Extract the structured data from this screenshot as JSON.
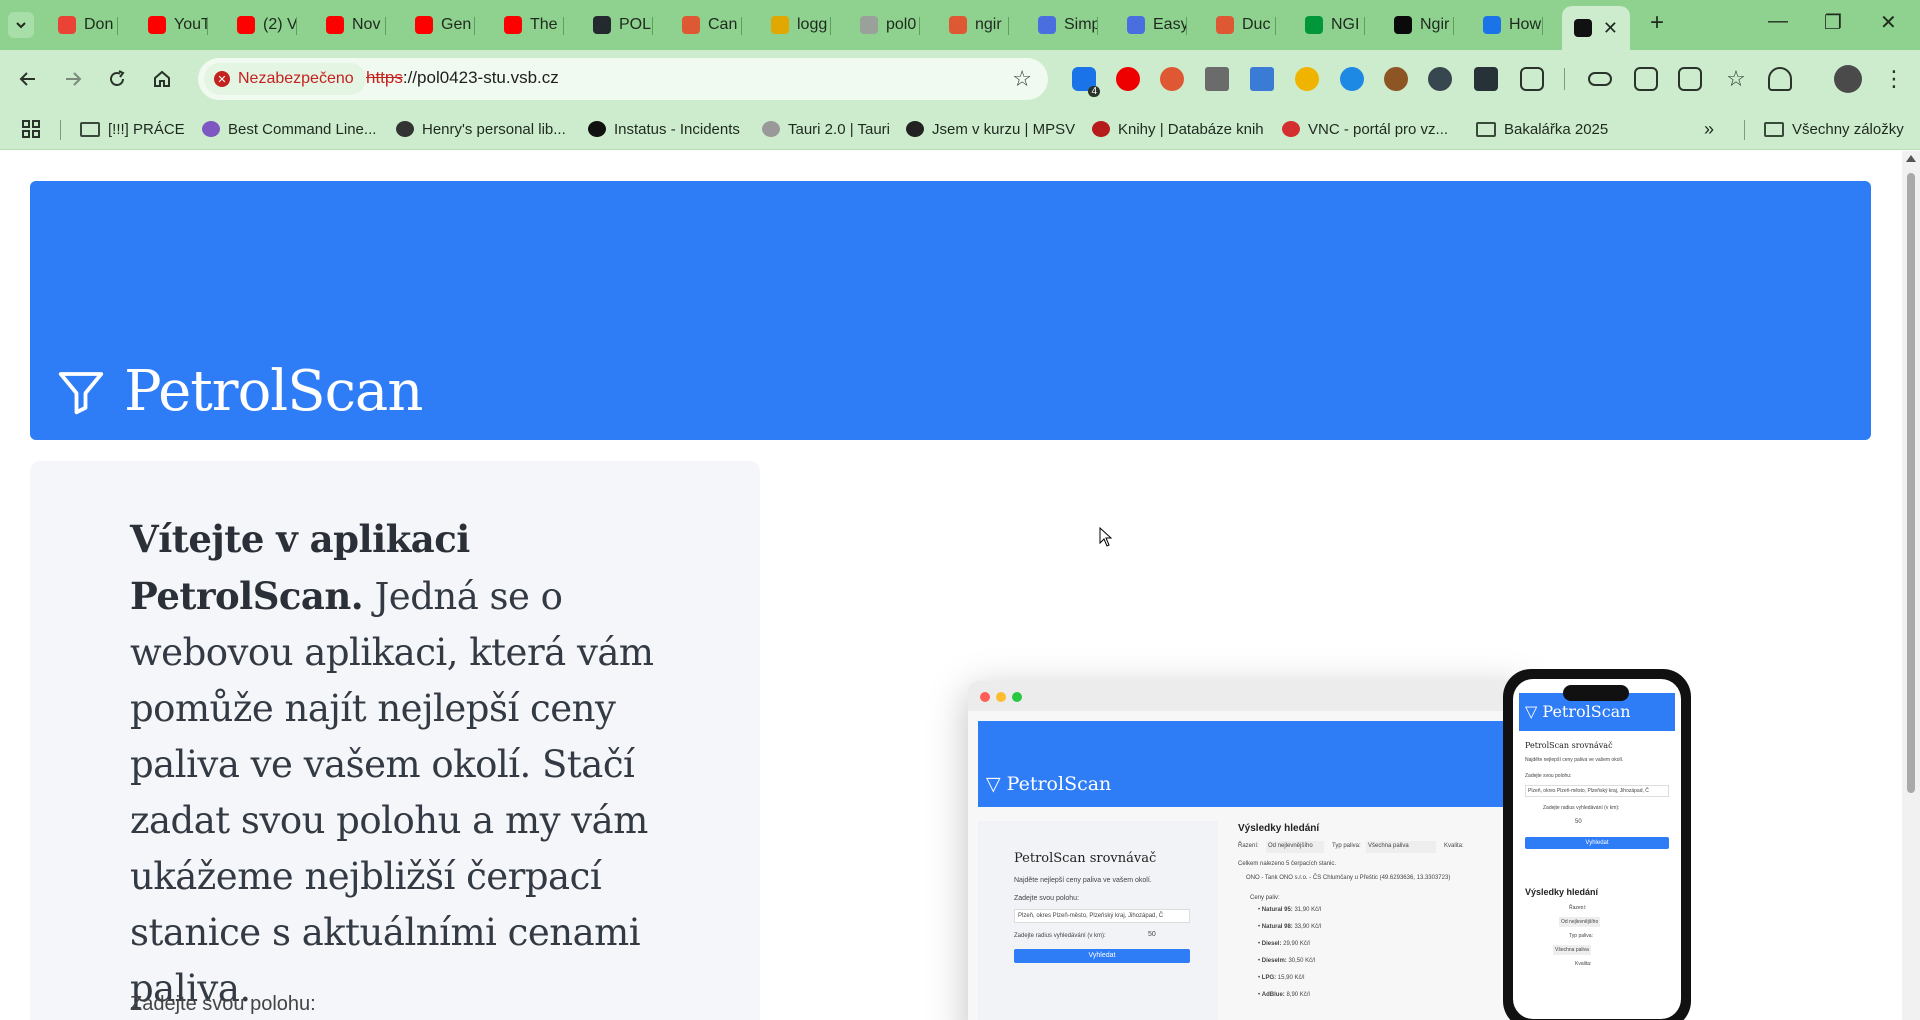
{
  "browser": {
    "tabs": [
      {
        "label": "Don",
        "favicon_color": "#ea4335",
        "favicon": "gmail-icon"
      },
      {
        "label": "YouT",
        "favicon_color": "#ff0000",
        "favicon": "youtube-icon"
      },
      {
        "label": "(2) V",
        "favicon_color": "#ff0000",
        "favicon": "youtube-icon"
      },
      {
        "label": "Nov",
        "favicon_color": "#ff0000",
        "favicon": "youtube-icon"
      },
      {
        "label": "Gen",
        "favicon_color": "#ff0000",
        "favicon": "youtube-icon"
      },
      {
        "label": "The",
        "favicon_color": "#ff0000",
        "favicon": "youtube-icon"
      },
      {
        "label": "POL",
        "favicon_color": "#24292f",
        "favicon": "github-icon"
      },
      {
        "label": "Can",
        "favicon_color": "#de5833",
        "favicon": "duckduckgo-icon"
      },
      {
        "label": "logg",
        "favicon_color": "#e0a800",
        "favicon": "logo-icon"
      },
      {
        "label": "pol0",
        "favicon_color": "#9aa09a",
        "favicon": "globe-icon"
      },
      {
        "label": "ngir",
        "favicon_color": "#de5833",
        "favicon": "duckduckgo-icon"
      },
      {
        "label": "Simp",
        "favicon_color": "#4a6ee0",
        "favicon": "azure-icon"
      },
      {
        "label": "Easy",
        "favicon_color": "#4a6ee0",
        "favicon": "azure-icon"
      },
      {
        "label": "Duc",
        "favicon_color": "#de5833",
        "favicon": "duckduckgo-icon"
      },
      {
        "label": "NGI",
        "favicon_color": "#009639",
        "favicon": "nginx-icon"
      },
      {
        "label": "Ngir",
        "favicon_color": "#0a0a0a",
        "favicon": "dev-icon"
      },
      {
        "label": "How",
        "favicon_color": "#1a73e8",
        "favicon": "loading-icon"
      },
      {
        "label": "",
        "favicon_color": "#111111",
        "favicon": "triangle-icon",
        "active": true
      }
    ],
    "security_label": "Nezabezpečeno",
    "url_scheme": "https",
    "url_rest": "://pol0423-stu.vsb.cz",
    "extension_badge": "4",
    "bookmarks": [
      {
        "label": "[!!!] PRÁCE",
        "type": "folder"
      },
      {
        "label": "Best Command Line...",
        "type": "link",
        "color": "#7e57c2"
      },
      {
        "label": "Henry's personal lib...",
        "type": "link",
        "color": "#333333"
      },
      {
        "label": "Instatus - Incidents",
        "type": "link",
        "color": "#111111"
      },
      {
        "label": "Tauri 2.0 | Tauri",
        "type": "link",
        "color": "#999999"
      },
      {
        "label": "Jsem v kurzu | MPSV",
        "type": "link",
        "color": "#222222"
      },
      {
        "label": "Knihy | Databáze knih",
        "type": "link",
        "color": "#b71c1c"
      },
      {
        "label": "VNC - portál pro vz...",
        "type": "link",
        "color": "#d32f2f"
      },
      {
        "label": "Bakalářka 2025",
        "type": "folder"
      }
    ],
    "all_bookmarks": "Všechny záložky"
  },
  "page": {
    "brand": "PetrolScan",
    "welcome_bold": "Vítejte v aplikaci PetrolScan.",
    "welcome_text": "Jedná se o webovou aplikaci, která vám pomůže najít nejlepší ceny paliva ve vašem okolí. Stačí zadat svou polohu a my vám ukážeme nejbližší čerpací stanice s aktuálními cenami paliva.",
    "location_label": "Zadejte svou polohu:",
    "accent_color": "#2e7cf6"
  },
  "mockup": {
    "brand": "PetrolScan",
    "comparator_title": "PetrolScan srovnávač",
    "comparator_sub": "Najděte nejlepší ceny paliva ve vašem okolí.",
    "location_label": "Zadejte svou polohu:",
    "location_value": "Plzeň, okres Plzeň-město, Plzeňský kraj, Jihozápad, Č",
    "radius_label": "Zadejte radius vyhledávání (v km):",
    "radius_value": "50",
    "search_button": "Vyhledat",
    "results_title": "Výsledky hledání",
    "results_count": "Celkem nalezeno 5 čerpacích stanic.",
    "station": "ONO - Tank ONO s.r.o. - ČS Chlumčany u Přeštic (49.6293636, 13.3303723)",
    "prices_label": "Ceny paliv:",
    "fuels": [
      {
        "name": "Natural 95:",
        "price": "31,90 Kč/l"
      },
      {
        "name": "Natural 98:",
        "price": "33,90 Kč/l"
      },
      {
        "name": "Diesel:",
        "price": "29,90 Kč/l"
      },
      {
        "name": "Dieselm:",
        "price": "30,50 Kč/l"
      },
      {
        "name": "LPG:",
        "price": "15,90 Kč/l"
      },
      {
        "name": "AdBlue:",
        "price": "8,90 Kč/l"
      }
    ],
    "sort_label": "Řazení:",
    "sort_value": "Od nejlevnějšího",
    "fuel_type_label": "Typ paliva:",
    "fuel_type_value": "Všechna paliva",
    "quality_label": "Kvalita:"
  }
}
